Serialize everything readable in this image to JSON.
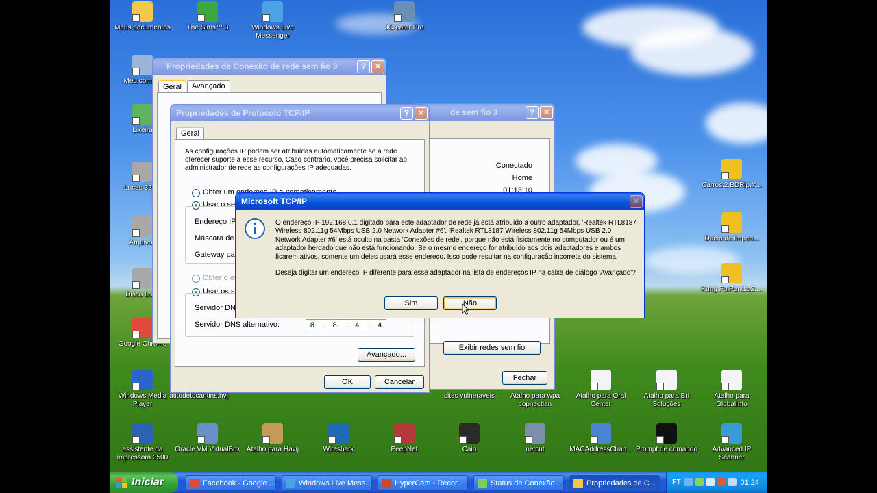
{
  "desktop_icons": [
    {
      "label": "Meus documentos",
      "icon": "my-documents-folder-icon",
      "color": "#f2c94c"
    },
    {
      "label": "The Sims™ 3",
      "icon": "the-sims-icon",
      "color": "#3aa83a"
    },
    {
      "label": "Windows Live Messenger",
      "icon": "messenger-icon",
      "color": "#4ba3e3"
    },
    {
      "label": "JCreator Pro",
      "icon": "jcreator-icon",
      "color": "#6a8fb5"
    },
    {
      "label": "Meu comput",
      "icon": "my-computer-icon",
      "color": "#9db4d9"
    },
    {
      "label": "Lixeira",
      "icon": "recycle-bin-icon",
      "color": "#5fb35f"
    },
    {
      "label": "Lucas 320G",
      "icon": "drive-icon",
      "color": "#a8a8a8"
    },
    {
      "label": "Arquivos",
      "icon": "drive-icon",
      "color": "#a8a8a8"
    },
    {
      "label": "Disco Loca",
      "icon": "drive-icon",
      "color": "#a8a8a8"
    },
    {
      "label": "Google Chrome",
      "icon": "chrome-icon",
      "color": "#e04a3a"
    },
    {
      "label": "Windows Media Player",
      "icon": "media-player-icon",
      "color": "#2a66c9"
    },
    {
      "label": "atitudetocantins.hvj",
      "icon": "file-icon",
      "color": "#dcdcdc"
    },
    {
      "label": "sites vulneraveis",
      "icon": "file-icon",
      "color": "#dcdcdc"
    },
    {
      "label": "Atalho para wpa copnectlan",
      "icon": "file-icon",
      "color": "#dcdcdc"
    },
    {
      "label": "Atalho para Oral Center",
      "icon": "text-file-icon",
      "color": "#f4f4f4"
    },
    {
      "label": "Atalho para Brt Soluções",
      "icon": "text-file-icon",
      "color": "#f4f4f4"
    },
    {
      "label": "Atalho para GlobalInfo",
      "icon": "text-file-icon",
      "color": "#f4f4f4"
    },
    {
      "label": "Carros.2.BDRip.X...",
      "icon": "video-file-icon",
      "color": "#f0c020"
    },
    {
      "label": "Duelo.de.Imperi...",
      "icon": "video-file-icon",
      "color": "#f0c020"
    },
    {
      "label": "Kung.Fu.Panda.2....",
      "icon": "video-file-icon",
      "color": "#f0c020"
    },
    {
      "label": "assistente da impressora 3500",
      "icon": "hp-icon",
      "color": "#2b62b5"
    },
    {
      "label": "Oracle VM VirtualBox",
      "icon": "virtualbox-icon",
      "color": "#6b8fc8"
    },
    {
      "label": "Atalho para Havij",
      "icon": "havij-icon",
      "color": "#c89a5a"
    },
    {
      "label": "Wireshark",
      "icon": "wireshark-icon",
      "color": "#1f6ab5"
    },
    {
      "label": "PeepNet",
      "icon": "peepnet-icon",
      "color": "#b73a3a"
    },
    {
      "label": "Cain",
      "icon": "cain-icon",
      "color": "#2a2a2a"
    },
    {
      "label": "netcut",
      "icon": "netcut-icon",
      "color": "#7b8fa8"
    },
    {
      "label": "MACAddressChan...",
      "icon": "network-icon",
      "color": "#4a86d0"
    },
    {
      "label": "Prompt de comando",
      "icon": "command-prompt-icon",
      "color": "#111111"
    },
    {
      "label": "Advanced IP Scanner",
      "icon": "ip-scanner-icon",
      "color": "#3a9ad8"
    }
  ],
  "win_conn_props": {
    "title": "Propriedades de Conexão de rede sem fio 3",
    "tabs": [
      "Geral",
      "Avançado"
    ]
  },
  "win_status": {
    "title_fragment": "de sem fio 3",
    "status": "Conectado",
    "network": "Home",
    "duration": "01:13:10",
    "view_networks_button": "Exibir redes sem fio",
    "close_button": "Fechar"
  },
  "win_tcpip": {
    "title": "Propriedades de Protocolo TCP/IP",
    "tab": "Geral",
    "intro": "As configurações IP podem ser atribuídas automaticamente se a rede oferecer suporte a esse recurso. Caso contrário, você precisa solicitar ao administrador de rede as configurações IP adequadas.",
    "radio_auto_ip": "Obter um endereço IP automaticamente",
    "radio_manual_ip": "Usar o seg",
    "label_ip": "Endereço IP:",
    "label_mask": "Máscara de s",
    "label_gateway": "Gateway pad",
    "radio_auto_dns": "Obter o en",
    "radio_manual_dns": "Usar os se",
    "label_dns_pref": "Servidor DNS",
    "label_dns_alt": "Servidor DNS alternativo:",
    "dns_alt_octets": [
      "8",
      "8",
      "4",
      "4"
    ],
    "advanced_button": "Avançado...",
    "ok_button": "OK",
    "cancel_button": "Cancelar"
  },
  "msgbox": {
    "title": "Microsoft TCP/IP",
    "message_1": "O endereço IP 192.168.0.1 digitado para este adaptador de rede já está atribuído a outro adaptador, 'Realtek RTL8187 Wireless 802.11g 54Mbps USB 2.0 Network Adapter #6'. 'Realtek RTL8187 Wireless 802.11g 54Mbps USB 2.0 Network Adapter #6' está oculto na pasta 'Conexões de rede', porque não está fisicamente no computador ou é um adaptador herdado que não está funcionando. Se o mesmo endereço for atribuído aos dois adaptadores e ambos ficarem ativos, somente um deles usará esse endereço. Isso pode resultar na configuração incorreta do sistema.",
    "message_2": "Deseja digitar um endereço IP diferente para esse adaptador na lista de endereços IP na caixa de diálogo 'Avançado'?",
    "yes_button": "Sim",
    "no_button": "Não"
  },
  "taskbar": {
    "start_label": "Iniciar",
    "buttons": [
      {
        "label": "Facebook - Google ...",
        "icon": "chrome-icon",
        "color": "#e04a3a"
      },
      {
        "label": "Windows Live Mess...",
        "icon": "messenger-icon",
        "color": "#4ba3e3"
      },
      {
        "label": "HyperCam - Recor...",
        "icon": "hypercam-icon",
        "color": "#c84a2a"
      },
      {
        "label": "Status de Conexão...",
        "icon": "wireless-icon",
        "color": "#7ccf5a"
      },
      {
        "label": "Propriedades de C...",
        "icon": "network-connection-icon",
        "color": "#f4c64a"
      }
    ],
    "language": "PT",
    "clock": "01:24"
  }
}
